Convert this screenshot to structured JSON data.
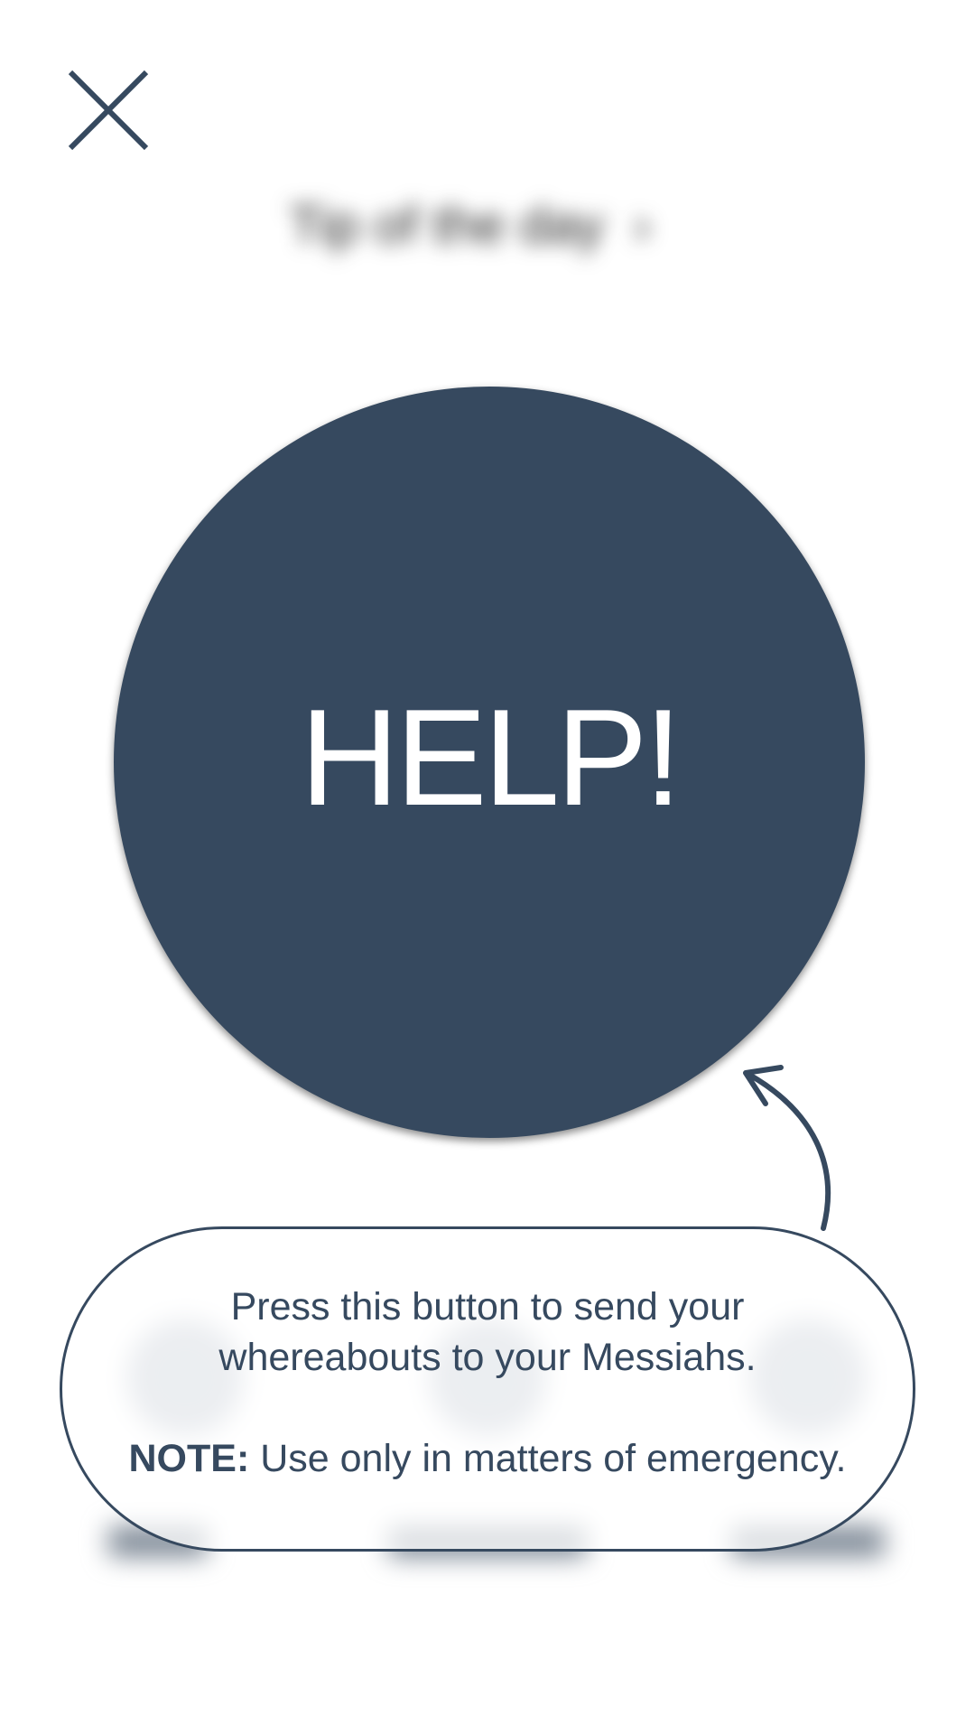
{
  "header": {
    "close_icon": "close-icon",
    "tip_of_day": "Tip of the day"
  },
  "help_button": {
    "label": "HELP!"
  },
  "callout": {
    "line1": "Press this button to send your",
    "line2": "whereabouts to your Messiahs.",
    "note_label": "NOTE:",
    "note_text": " Use only in matters of emergency."
  },
  "colors": {
    "primary": "#36495f",
    "background": "#ffffff",
    "text_on_primary": "#ffffff"
  }
}
